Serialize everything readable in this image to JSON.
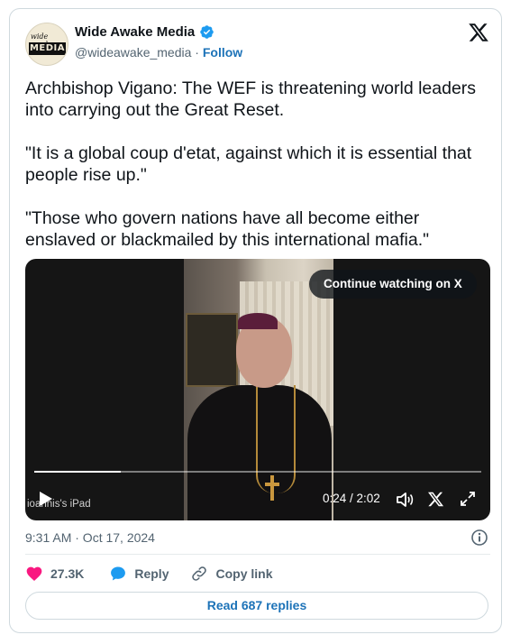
{
  "account": {
    "avatar_top_text": "wide awake",
    "avatar_bottom_text": "MEDIA",
    "name": "Wide Awake Media",
    "handle": "@wideawake_media",
    "separator": "·",
    "follow_label": "Follow"
  },
  "tweet": {
    "paragraphs": [
      "Archbishop Vigano: The WEF is threatening world leaders into carrying out the Great Reset.",
      "\"It is a global coup d'etat, against which it is essential that people rise up.\"",
      "\"Those who govern nations have all become either enslaved or blackmailed by this international mafia.\""
    ]
  },
  "video": {
    "continue_label": "Continue watching on X",
    "time_text": "0:24 / 2:02",
    "progress": 0.193,
    "watermark": "ioannis's iPad"
  },
  "meta": {
    "timestamp": "9:31 AM · Oct 17, 2024"
  },
  "actions": {
    "likes": "27.3K",
    "reply_label": "Reply",
    "copy_label": "Copy link"
  },
  "replies_button": "Read 687 replies",
  "colors": {
    "link": "#1d73b8",
    "like": "#f91880",
    "reply": "#1d9bf0",
    "verified": "#1d9bf0"
  },
  "icons": [
    "verified-badge-icon",
    "x-logo-icon",
    "play-icon",
    "volume-icon",
    "x-small-icon",
    "fullscreen-icon",
    "info-icon",
    "heart-icon",
    "reply-bubble-icon",
    "link-icon"
  ]
}
